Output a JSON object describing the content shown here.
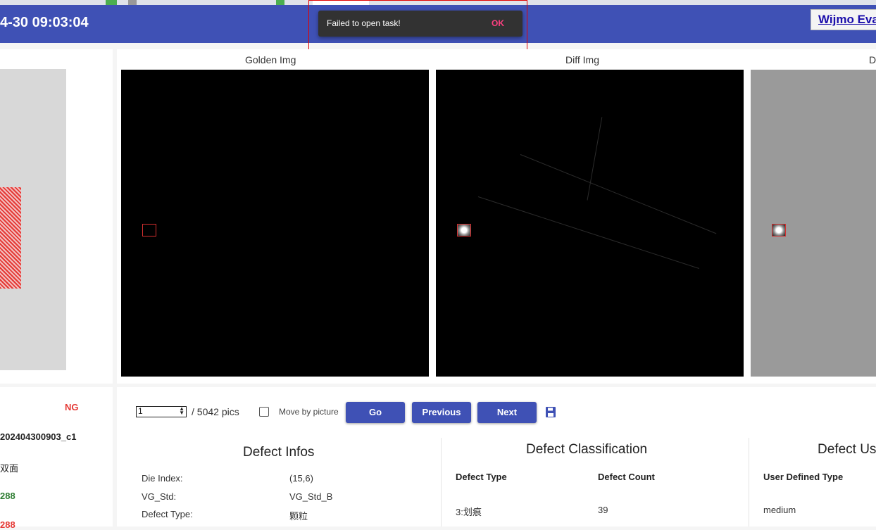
{
  "header": {
    "datetime": "4-30 09:03:04",
    "brand": "Wijmo Eva"
  },
  "toast": {
    "message": "Failed to open task!",
    "action": "OK"
  },
  "left_info": {
    "result": "NG",
    "task_id": "202404300903_c1",
    "side": "双面",
    "count_green": "288",
    "count_red": "288"
  },
  "images": {
    "titles": [
      "Golden Img",
      "Diff Img",
      "D"
    ]
  },
  "pager": {
    "current": "1",
    "total": "/ 5042 pics",
    "move_by_picture": "Move by picture",
    "go": "Go",
    "previous": "Previous",
    "next": "Next",
    "save_icon": "save-icon"
  },
  "defect_infos": {
    "title": "Defect Infos",
    "rows": [
      {
        "label": "Die Index:",
        "value": "(15,6)"
      },
      {
        "label": "VG_Std:",
        "value": "VG_Std_B"
      },
      {
        "label": "Defect Type:",
        "value": "颗粒"
      }
    ]
  },
  "defect_classification": {
    "title": "Defect Classification",
    "headers": [
      "Defect Type",
      "Defect Count"
    ],
    "rows": [
      [
        "3:划痕",
        "39"
      ]
    ]
  },
  "defect_user": {
    "title": "Defect Us",
    "header": "User Defined Type",
    "value": "medium"
  },
  "colors": {
    "primary": "#3f51b5",
    "ng_red": "#e53935",
    "ok_green": "#2e7d32",
    "toast_action": "#ff4081"
  }
}
